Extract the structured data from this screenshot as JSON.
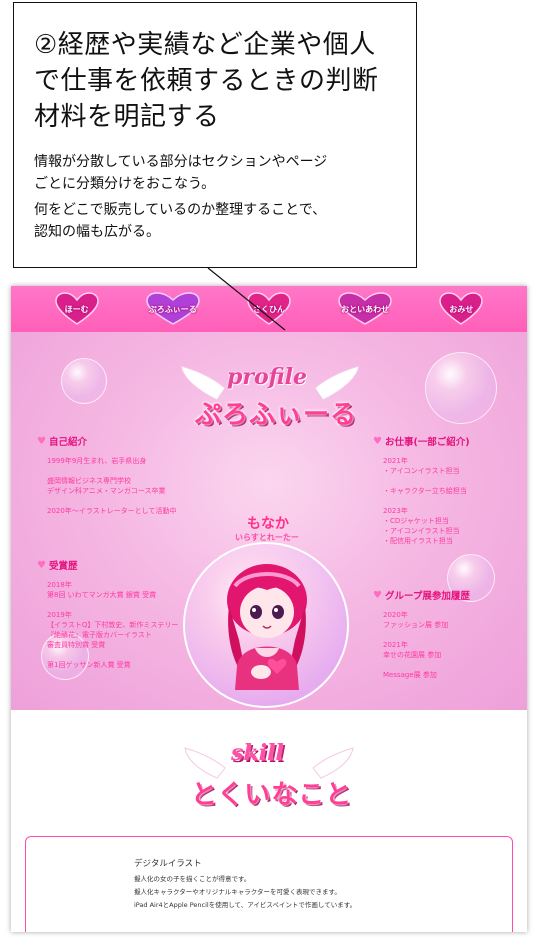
{
  "callout": {
    "title_line1": "②経歴や実績など企業や個人",
    "title_line2": "で仕事を依頼するときの判断",
    "title_line3": "材料を明記する",
    "body_line1": "情報が分散している部分はセクションやページ",
    "body_line2": "ごとに分類分けをおこなう。",
    "body_line3": "何をどこで販売しているのか整理することで、",
    "body_line4": "認知の幅も広がる。"
  },
  "nav": {
    "items": [
      {
        "label": "ほーむ"
      },
      {
        "label": "ぷろふぃーる"
      },
      {
        "label": "さくひん"
      },
      {
        "label": "おといあわせ"
      },
      {
        "label": "おみせ"
      }
    ]
  },
  "profile": {
    "logo_top": "profile",
    "logo_main": "ぷろふぃーる",
    "intro": {
      "heading": "自己紹介",
      "lines": [
        "1999年9月生まれ、岩手県出身",
        "盛岡情報ビジネス専門学校",
        "デザイン科アニメ・マンガコース卒業",
        "2020年～イラストレーターとして活動中"
      ]
    },
    "awards": {
      "heading": "受賞歴",
      "lines": [
        "2018年",
        "第8回 いわてマンガ大賞 銀賞 受賞",
        "2019年",
        "【イラストQ】下村敦史、新作ミステリー",
        "『絶鱗花』電子版カバーイラスト",
        "審査員特別賞 受賞",
        "第1回ゲッサン新人賞 受賞"
      ]
    },
    "character": {
      "name": "もなか",
      "subtitle": "いらすとれーたー"
    },
    "works": {
      "heading": "お仕事(一部ご紹介)",
      "lines": [
        "2021年",
        "・アイコンイラスト担当",
        "・キャラクター立ち絵担当",
        "2023年",
        "・CDジャケット担当",
        "・アイコンイラスト担当",
        "・配信用イラスト担当"
      ]
    },
    "group": {
      "heading": "グループ展参加履歴",
      "lines": [
        "2020年",
        "ファッション展 参加",
        "2021年",
        "幸せの花園展 参加",
        "Message展 参加"
      ]
    }
  },
  "skill": {
    "logo_top": "skill",
    "logo_main": "とくいなこと",
    "card_title": "デジタルイラスト",
    "card_lines": [
      "擬人化の女の子を描くことが得意です。",
      "擬人化キャラクターやオリジナルキャラクターを可愛く表現できます。",
      "iPad Air4とApple Pencilを使用して、アイビスペイントで作画しています。"
    ]
  },
  "colors": {
    "nav_pink": "#ff6fc2",
    "accent_pink": "#ff3aa0",
    "heading_pink": "#e4157e",
    "profile_bg": "#f5b7e3"
  }
}
